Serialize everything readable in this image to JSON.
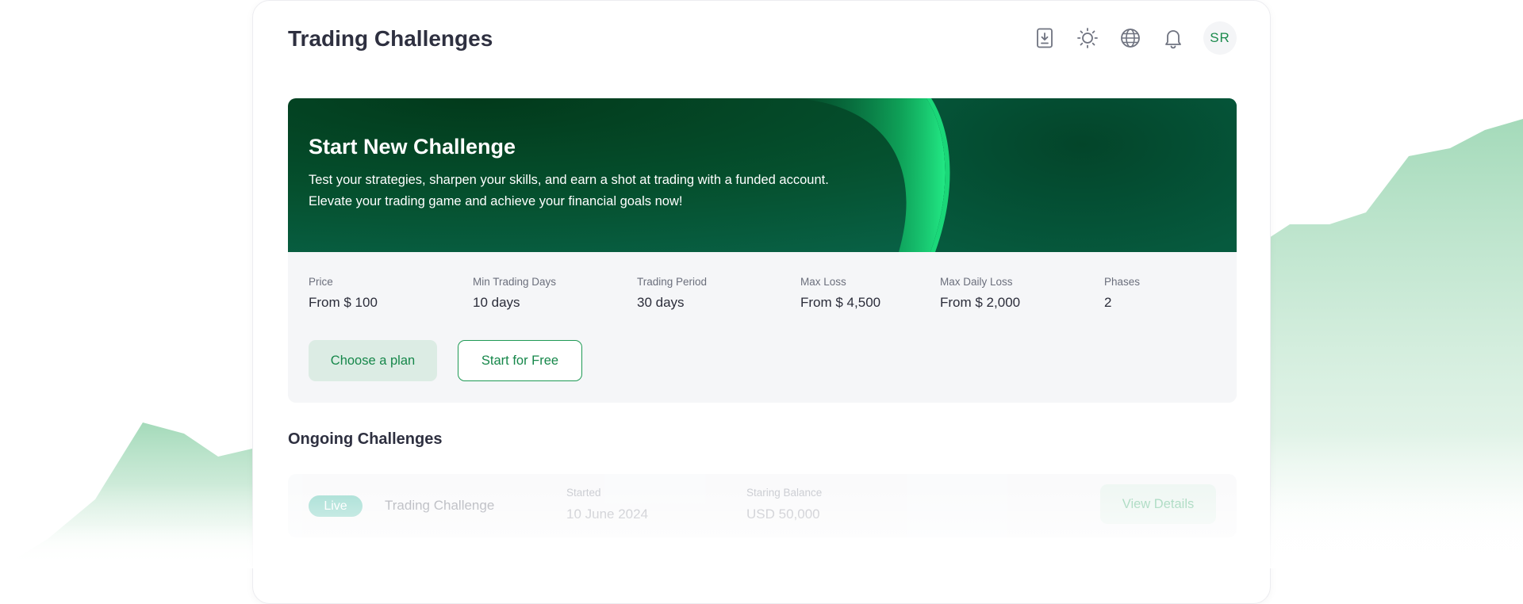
{
  "header": {
    "title": "Trading Challenges",
    "icons": [
      "download-document-icon",
      "sun-icon",
      "globe-icon",
      "bell-icon"
    ],
    "avatar_initials": "SR"
  },
  "banner": {
    "title": "Start New Challenge",
    "description_line1": "Test your strategies, sharpen your skills, and earn a shot at trading with a funded account.",
    "description_line2": "Elevate your trading game and achieve your financial goals now!"
  },
  "details": {
    "stats": [
      {
        "label": "Price",
        "value": "From $ 100"
      },
      {
        "label": "Min Trading Days",
        "value": "10 days"
      },
      {
        "label": "Trading Period",
        "value": "30 days"
      },
      {
        "label": "Max Loss",
        "value": "From $ 4,500"
      },
      {
        "label": "Max Daily Loss",
        "value": "From $ 2,000"
      },
      {
        "label": "Phases",
        "value": "2"
      }
    ],
    "choose_plan_label": "Choose a plan",
    "start_free_label": "Start for Free"
  },
  "ongoing": {
    "section_title": "Ongoing Challenges",
    "rows": [
      {
        "status": "Live",
        "name": "Trading Challenge",
        "started_label": "Started",
        "started_value": "10 June 2024",
        "balance_label": "Staring Balance",
        "balance_value": "USD 50,000",
        "action_label": "View Details"
      }
    ]
  },
  "colors": {
    "accent": "#1b8a4c",
    "banner_dark": "#023a1b",
    "banner_glow": "#19e07a",
    "background_chart": "#a8dcbc"
  }
}
